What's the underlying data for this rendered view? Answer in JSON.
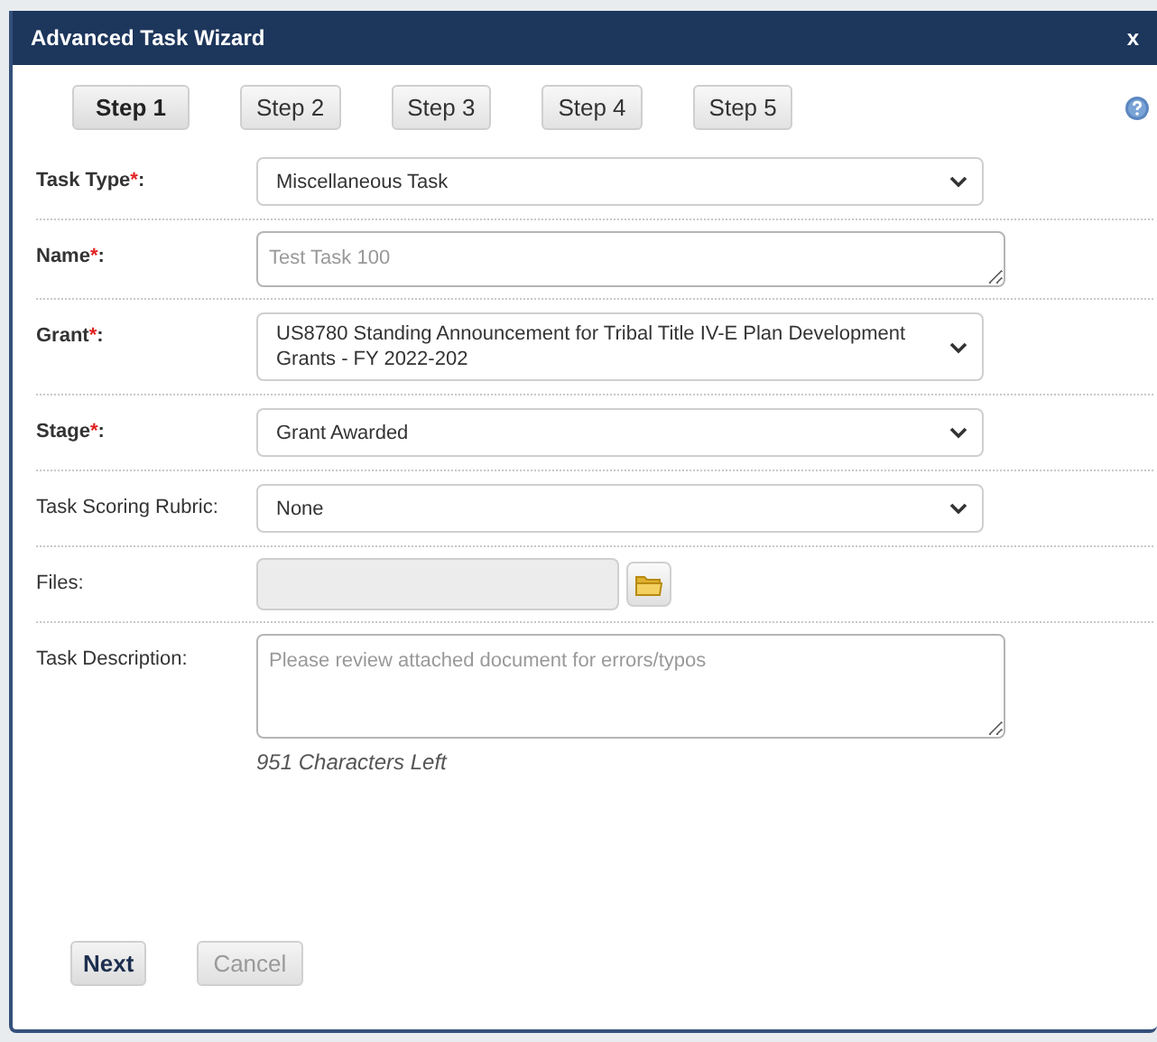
{
  "dialog": {
    "title": "Advanced Task Wizard",
    "close": "x"
  },
  "steps": [
    {
      "label": "Step 1",
      "selected": true
    },
    {
      "label": "Step 2",
      "selected": false
    },
    {
      "label": "Step 3",
      "selected": false
    },
    {
      "label": "Step 4",
      "selected": false
    },
    {
      "label": "Step 5",
      "selected": false
    }
  ],
  "fields": [
    {
      "kind": "select",
      "label": "Task Type",
      "required": true,
      "required_mark": "*",
      "suffix": ":",
      "value": "Miscellaneous Task"
    },
    {
      "kind": "textarea",
      "label": "Name",
      "required": true,
      "required_mark": "*",
      "suffix": ":",
      "placeholder": "Test Task 100"
    },
    {
      "kind": "select",
      "label": "Grant",
      "required": true,
      "required_mark": "*",
      "suffix": ":",
      "value": "US8780 Standing Announcement for Tribal Title IV-E Plan Development Grants - FY 2022-202"
    },
    {
      "kind": "select",
      "label": "Stage",
      "required": true,
      "required_mark": "*",
      "suffix": ":",
      "value": "Grant Awarded"
    },
    {
      "kind": "select",
      "label": "Task Scoring Rubric",
      "required": false,
      "suffix": ":",
      "value": "None"
    },
    {
      "kind": "file",
      "label": "Files",
      "required": false,
      "suffix": ":"
    },
    {
      "kind": "description",
      "label": "Task Description",
      "required": false,
      "suffix": ":",
      "placeholder": "Please review attached document for errors/typos",
      "counter": "951 Characters Left"
    }
  ],
  "buttons": [
    {
      "label": "Next",
      "disabled": false
    },
    {
      "label": "Cancel",
      "disabled": true
    }
  ]
}
